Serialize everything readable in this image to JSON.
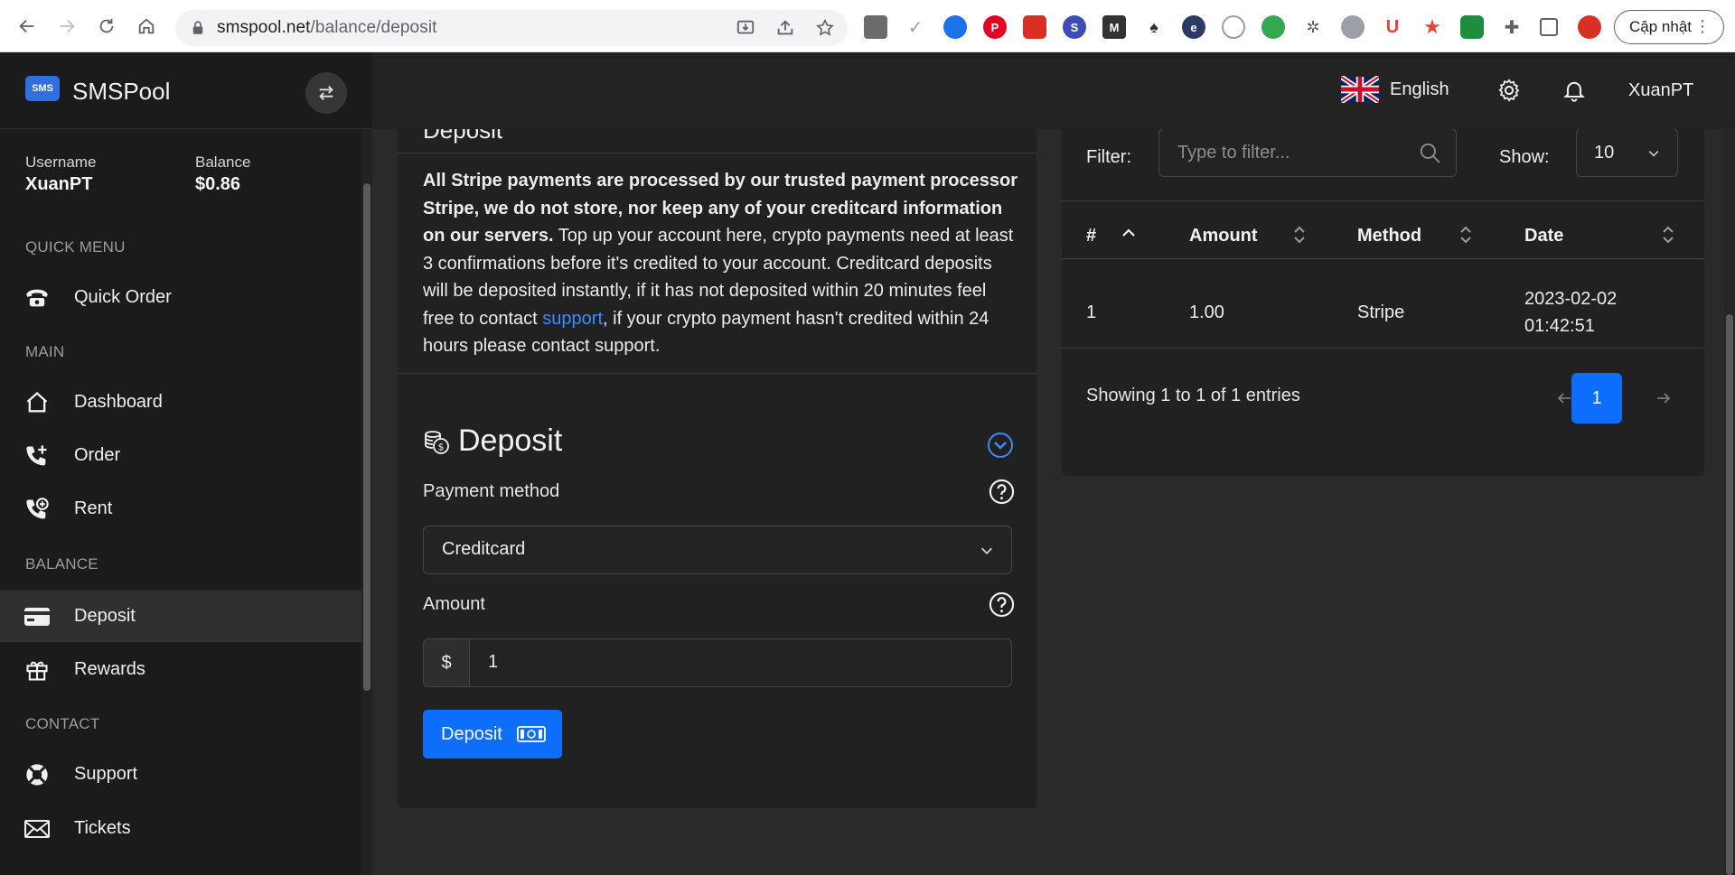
{
  "browser": {
    "url_host": "smspool.net",
    "url_path": "/balance/deposit",
    "update_button": "Cập nhật"
  },
  "sidebar": {
    "logo_text": "SMS",
    "brand": "SMSPool",
    "username_label": "Username",
    "username": "XuanPT",
    "balance_label": "Balance",
    "balance": "$0.86",
    "sections": {
      "quick_menu": "QUICK MENU",
      "main": "MAIN",
      "balance": "BALANCE",
      "contact": "CONTACT"
    },
    "items": {
      "quick_order": "Quick Order",
      "dashboard": "Dashboard",
      "order": "Order",
      "rent": "Rent",
      "deposit": "Deposit",
      "rewards": "Rewards",
      "support": "Support",
      "tickets": "Tickets"
    },
    "active_item": "Deposit"
  },
  "topbar": {
    "language": "English",
    "user": "XuanPT"
  },
  "deposit_card": {
    "header_title": "Deposit",
    "notice_bold": "All Stripe payments are processed by our trusted payment processor Stripe, we do not store, nor keep any of your creditcard information on our servers.",
    "notice_text_1": " Top up your account here, crypto payments need at least 3 confirmations before it's credited to your account. Creditcard deposits will be deposited instantly, if it has not deposited within 20 minutes feel free to contact ",
    "notice_link": "support",
    "notice_text_2": ", if your crypto payment hasn't credited within 24 hours please contact support.",
    "form_title": "Deposit",
    "payment_method_label": "Payment method",
    "payment_method_value": "Creditcard",
    "amount_label": "Amount",
    "currency_prefix": "$",
    "amount_value": "1",
    "submit_label": "Deposit"
  },
  "history": {
    "filter_label": "Filter:",
    "filter_placeholder": "Type to filter...",
    "show_label": "Show:",
    "show_value": "10",
    "columns": [
      "#",
      "Amount",
      "Method",
      "Date"
    ],
    "rows": [
      {
        "num": "1",
        "amount": "1.00",
        "method": "Stripe",
        "date_line1": "2023-02-02",
        "date_line2": "01:42:51"
      }
    ],
    "entries_text": "Showing 1 to 1 of 1 entries",
    "current_page": "1"
  },
  "colors": {
    "accent": "#0d6efd",
    "link": "#3d8bfd",
    "sidebar_bg": "#1b1b1b",
    "card_bg": "#212121",
    "page_bg": "#2a2a2a"
  }
}
